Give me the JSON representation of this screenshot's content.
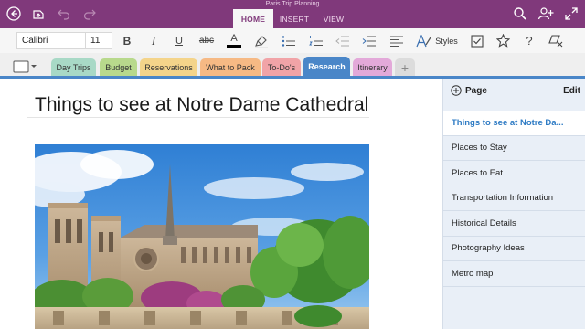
{
  "window": {
    "title": "Paris Trip Planning"
  },
  "ribbon": {
    "tabs": [
      {
        "label": "HOME",
        "active": true
      },
      {
        "label": "INSERT",
        "active": false
      },
      {
        "label": "VIEW",
        "active": false
      }
    ],
    "icons": {
      "back": "back-arrow-icon",
      "sync": "sync-icon",
      "undo": "undo-icon",
      "redo": "redo-icon",
      "search": "search-icon",
      "share": "add-person-icon",
      "fullscreen": "expand-icon"
    }
  },
  "format_toolbar": {
    "font_name": "Calibri",
    "font_size": "11",
    "bold_label": "B",
    "italic_label": "I",
    "underline_label": "U",
    "strike_label": "abc",
    "font_color_label": "A",
    "styles_label": "Styles",
    "help_label": "?",
    "font_color": "#000000"
  },
  "sections": [
    {
      "label": "Day Trips",
      "color": "#a8d9c6"
    },
    {
      "label": "Budget",
      "color": "#b8d98c"
    },
    {
      "label": "Reservations",
      "color": "#f4d48a"
    },
    {
      "label": "What to Pack",
      "color": "#f6b984"
    },
    {
      "label": "To-Do's",
      "color": "#f1a3a7"
    },
    {
      "label": "Research",
      "color": "#4a86c8",
      "active": true
    },
    {
      "label": "Itinerary",
      "color": "#e3a9d9"
    }
  ],
  "add_section_label": "+",
  "page": {
    "title": "Things to see at Notre Dame Cathedral",
    "image": "notre-dame-photo"
  },
  "page_panel": {
    "add_label": "Page",
    "edit_label": "Edit",
    "items": [
      {
        "label": "Things to see at Notre Da...",
        "active": true
      },
      {
        "label": "Places to Stay"
      },
      {
        "label": "Places to Eat"
      },
      {
        "label": "Transportation Information"
      },
      {
        "label": "Historical Details"
      },
      {
        "label": "Photography Ideas"
      },
      {
        "label": "Metro map"
      }
    ]
  },
  "colors": {
    "ribbon": "#80397b",
    "active_section": "#4a86c8",
    "active_page_text": "#2e7bc4",
    "panel_bg": "#e9eff7"
  }
}
